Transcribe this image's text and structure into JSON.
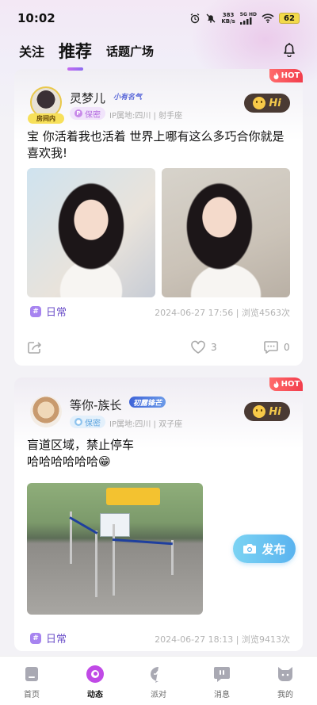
{
  "status_bar": {
    "time": "10:02",
    "net_speed_value": "383",
    "net_speed_unit": "KB/s",
    "network_label": "5G HD",
    "battery": "62"
  },
  "top_tabs": [
    {
      "label": "关注"
    },
    {
      "label": "推荐",
      "active": true
    },
    {
      "label": "话题广场"
    }
  ],
  "icons": {
    "notification": "bell-icon",
    "hot": "fire-icon",
    "hi": "smiley-icon",
    "share": "share-icon",
    "like": "heart-icon",
    "comment": "comment-icon",
    "publish": "camera-icon"
  },
  "posts": [
    {
      "hot_label": "HOT",
      "avatar_tag": "房间内",
      "username": "灵梦儿",
      "badge": "小有名气",
      "privacy": "保密",
      "privacy_letter": "P",
      "ip_info": "IP属地:四川 | 射手座",
      "hi_label": "Hi",
      "text": "宝 你活着我也活着 世界上哪有这么多巧合你就是喜欢我!",
      "topic": "日常",
      "meta": "2024-06-27 17:56 | 浏览4563次",
      "likes": "3",
      "comments": "0"
    },
    {
      "hot_label": "HOT",
      "username": "等你-族长",
      "badge": "初露锋芒",
      "privacy": "保密",
      "ip_info": "IP属地:四川 | 双子座",
      "hi_label": "Hi",
      "text_line1": "盲道区域，禁止停车",
      "text_line2": "哈哈哈哈哈哈😁",
      "topic": "日常",
      "meta": "2024-06-27 18:13 | 浏览9413次"
    }
  ],
  "publish_button": {
    "label": "发布"
  },
  "bottom_nav": [
    {
      "label": "首页"
    },
    {
      "label": "动态",
      "active": true
    },
    {
      "label": "派对"
    },
    {
      "label": "消息"
    },
    {
      "label": "我的"
    }
  ],
  "colors": {
    "accent": "#a784f0",
    "hot": "#f23d4c",
    "publish": "#5ab3ef",
    "hi_bg": "#4a3a33"
  }
}
